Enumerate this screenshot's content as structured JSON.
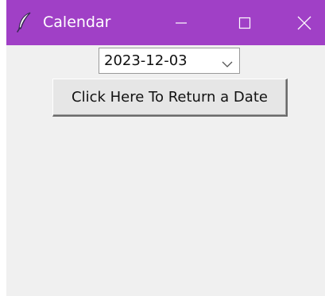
{
  "window": {
    "title": "Calendar",
    "titlebar_color": "#a040c6",
    "app_icon": "feather-icon",
    "controls": {
      "minimize_icon": "minimize-icon",
      "maximize_icon": "maximize-icon",
      "close_icon": "close-icon"
    }
  },
  "date_picker": {
    "value": "2023-12-03",
    "dropdown_icon": "chevron-down-icon"
  },
  "return_button": {
    "label": "Click Here To Return a Date"
  }
}
